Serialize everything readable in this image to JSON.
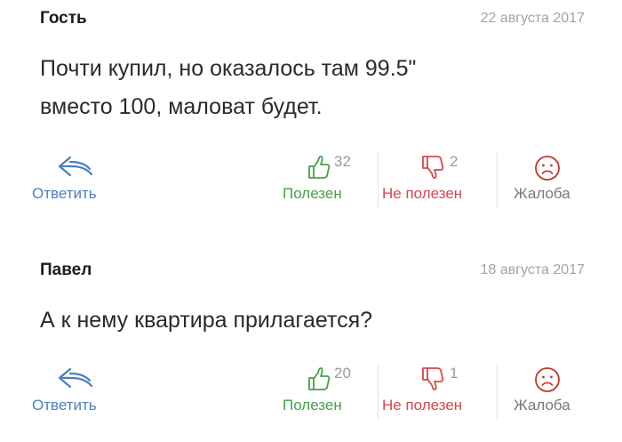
{
  "comments": [
    {
      "author": "Гость",
      "date": "22 августа 2017",
      "text_lines": [
        "Почти купил, но оказалось там 99.5\"",
        "вместо 100, маловат будет."
      ],
      "actions": {
        "reply_label": "Ответить",
        "useful_label": "Полезен",
        "useful_count": "32",
        "not_useful_label": "Не полезен",
        "not_useful_count": "2",
        "complaint_label": "Жалоба"
      }
    },
    {
      "author": "Павел",
      "date": "18 августа 2017",
      "text_lines": [
        "А к нему квартира прилагается?"
      ],
      "actions": {
        "reply_label": "Ответить",
        "useful_label": "Полезен",
        "useful_count": "20",
        "not_useful_label": "Не полезен",
        "not_useful_count": "1",
        "complaint_label": "Жалоба"
      }
    }
  ],
  "colors": {
    "reply": "#4a7fc1",
    "useful": "#46a04a",
    "not_useful": "#d8474d",
    "complaint": "#777777",
    "date": "#a3a3a3"
  },
  "icons": {
    "reply": "reply-arrow-icon",
    "useful": "thumbs-up-icon",
    "not_useful": "thumbs-down-icon",
    "complaint": "sad-face-icon"
  }
}
